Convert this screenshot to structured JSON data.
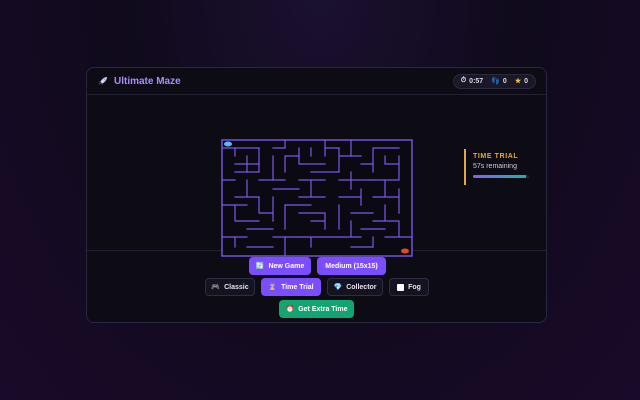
{
  "header": {
    "title": "Ultimate Maze",
    "timer": "0:57",
    "moves": "0",
    "stars": "0"
  },
  "side_panel": {
    "title": "TIME TRIAL",
    "subtitle": "57s remaining",
    "progress": 0.95
  },
  "controls": {
    "new_game": "New Game",
    "difficulty": "Medium (15x15)",
    "modes": [
      {
        "label": "Classic",
        "active": false,
        "icon": "gamepad-icon"
      },
      {
        "label": "Time Trial",
        "active": true,
        "icon": "hourglass-icon"
      },
      {
        "label": "Collector",
        "active": false,
        "icon": "gem-icon"
      },
      {
        "label": "Fog",
        "active": false,
        "icon": "square-icon"
      }
    ],
    "extra_time": "Get Extra Time"
  },
  "colors": {
    "accent": "#7c4dff",
    "maze_wall": "#7b58e8",
    "player": "#5ab8ff",
    "goal": "#e2462b",
    "timer_accent": "#e6a83a",
    "extra_time": "#12a572"
  }
}
